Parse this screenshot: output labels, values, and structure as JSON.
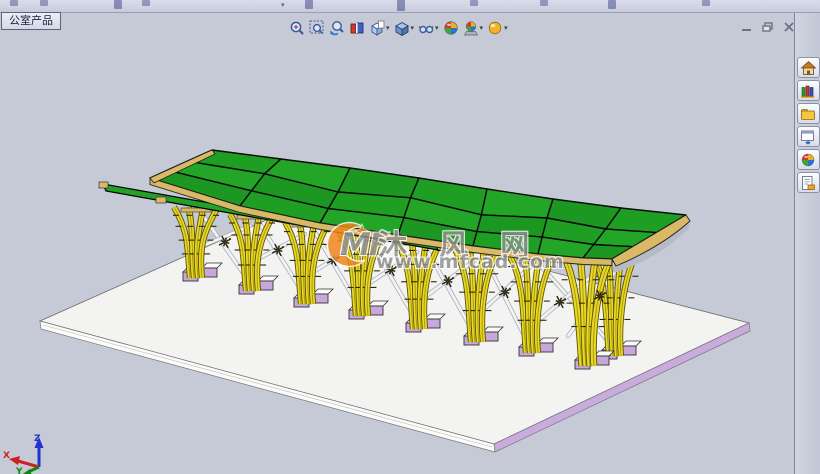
{
  "document_tab": {
    "label": "公室产品"
  },
  "window_controls": {
    "minimize": "minimize",
    "restore": "restore",
    "close": "close"
  },
  "headsup_toolbar": {
    "items": [
      {
        "name": "zoom-to-fit",
        "dropdown": false
      },
      {
        "name": "zoom-to-area",
        "dropdown": false
      },
      {
        "name": "previous-view",
        "dropdown": false
      },
      {
        "name": "section-view",
        "dropdown": false
      },
      {
        "name": "view-orientation",
        "dropdown": true
      },
      {
        "name": "display-style",
        "dropdown": true
      },
      {
        "name": "hide-show-items",
        "dropdown": true
      },
      {
        "name": "edit-appearance",
        "dropdown": false
      },
      {
        "name": "apply-scene",
        "dropdown": true
      },
      {
        "name": "view-settings",
        "dropdown": true
      }
    ]
  },
  "task_pane": {
    "items": [
      {
        "name": "solidworks-resources"
      },
      {
        "name": "design-library"
      },
      {
        "name": "file-explorer"
      },
      {
        "name": "view-palette"
      },
      {
        "name": "appearances-scenes"
      },
      {
        "name": "custom-properties"
      }
    ]
  },
  "watermark": {
    "logo": "MF",
    "title": "沐 风 网",
    "url": "www.mfcad.com"
  },
  "triad": {
    "x_label": "X",
    "y_label": "Y",
    "z_label": "Z"
  },
  "scene": {
    "description": "3D canopy model: green paneled wavy roof on bamboo-bundle columns with white cross struts, purple footing blocks, white rectangular platform",
    "part_colors": {
      "roof_panels": "#21a126",
      "roof_fascia": "#d9b966",
      "columns": "#e9d826",
      "footings": "#c6a8db",
      "struts": "#f2f2f2",
      "platform_top": "#f3f3f1",
      "platform_edge_right": "#c9abdd"
    }
  },
  "colors": {
    "viewport_bg": "#c5cad6",
    "roof_green": "#21a126",
    "fascia_tan": "#d9b966",
    "column_yellow": "#e9d826",
    "base_purple": "#c6a8db",
    "platform_white": "#f3f3f1",
    "strut_white": "#f2f2f2",
    "triad_x": "#cc2222",
    "triad_y": "#118811",
    "triad_z": "#2233cc"
  }
}
